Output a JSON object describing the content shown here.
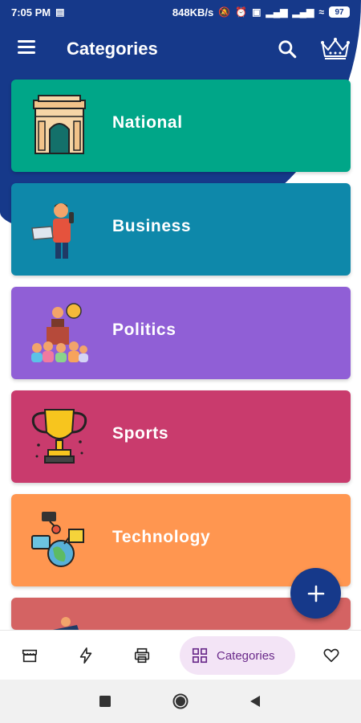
{
  "status_bar": {
    "time": "7:05 PM",
    "network_speed": "848KB/s",
    "battery": "97"
  },
  "app_bar": {
    "title": "Categories",
    "menu_icon": "menu-icon",
    "search_icon": "search-icon",
    "premium_icon": "crown-icon"
  },
  "categories": [
    {
      "label": "National",
      "color": "#00a688",
      "icon": "india-gate-icon"
    },
    {
      "label": "Business",
      "color": "#0e88aa",
      "icon": "businessman-icon"
    },
    {
      "label": "Politics",
      "color": "#905fd6",
      "icon": "politician-icon"
    },
    {
      "label": "Sports",
      "color": "#c93b6d",
      "icon": "trophy-icon"
    },
    {
      "label": "Technology",
      "color": "#ff9650",
      "icon": "technology-icon"
    },
    {
      "label": "",
      "color": "#d46363",
      "icon": "runner-icon"
    }
  ],
  "fab": {
    "icon": "plus-icon"
  },
  "bottom_nav": {
    "items": [
      "store-icon",
      "flash-icon",
      "printer-icon",
      "categories-icon",
      "heart-icon"
    ],
    "active_label": "Categories",
    "active_bg": "#f3e4f6",
    "active_color": "#6a2a8a"
  },
  "colors": {
    "header": "#16398a"
  }
}
